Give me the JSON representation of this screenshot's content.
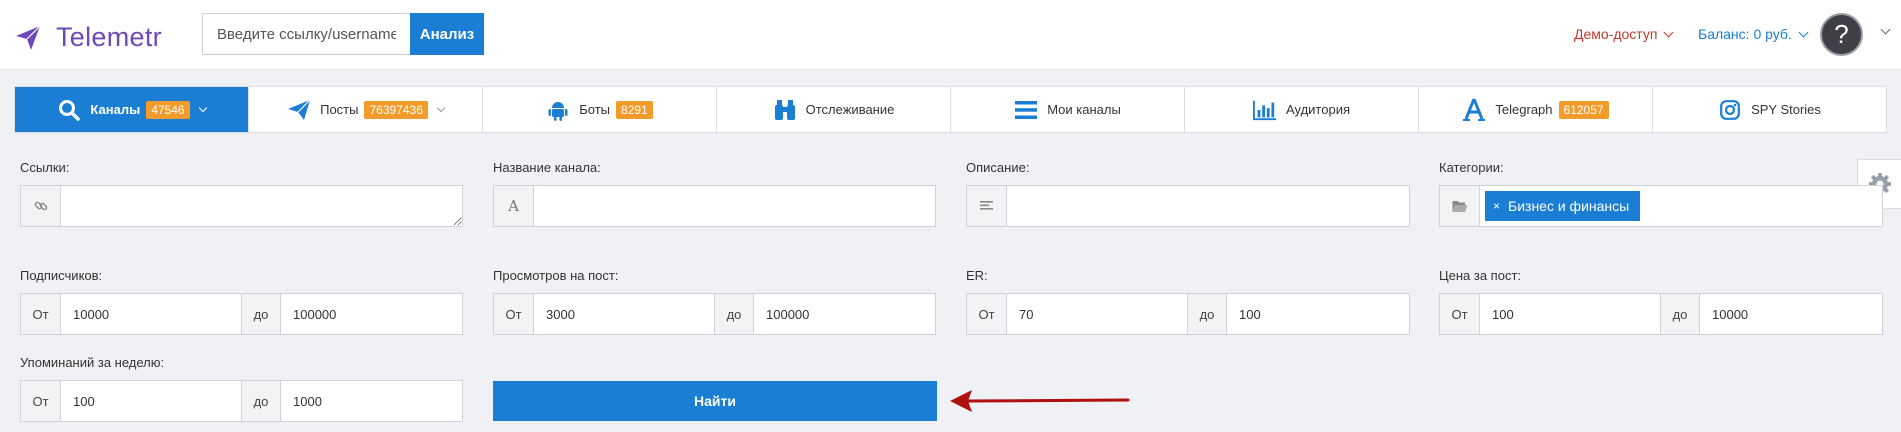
{
  "header": {
    "logo_text": "Telemetr",
    "search_placeholder": "Введите ссылку/username",
    "analyze_label": "Анализ",
    "demo_label": "Демо-доступ",
    "balance_label": "Баланс: 0 руб.",
    "avatar_glyph": "?"
  },
  "nav": {
    "tabs": [
      {
        "label": "Каналы",
        "badge": "47546"
      },
      {
        "label": "Посты",
        "badge": "76397436"
      },
      {
        "label": "Боты",
        "badge": "8291"
      },
      {
        "label": "Отслеживание"
      },
      {
        "label": "Мои каналы"
      },
      {
        "label": "Аудитория"
      },
      {
        "label": "Telegraph",
        "badge": "612057"
      },
      {
        "label": "SPY Stories"
      }
    ]
  },
  "filters": {
    "links_label": "Ссылки:",
    "channel_name_label": "Название канала:",
    "description_label": "Описание:",
    "categories_label": "Категории:",
    "category_chip": "Бизнес и финансы",
    "chip_remove": "×",
    "subscribers_label": "Подписчиков:",
    "views_label": "Просмотров на пост:",
    "er_label": "ER:",
    "price_label": "Цена за пост:",
    "mentions_label": "Упоминаний за неделю:",
    "from_label": "От",
    "to_label": "до",
    "subscribers_from": "10000",
    "subscribers_to": "100000",
    "views_from": "3000",
    "views_to": "100000",
    "er_from": "70",
    "er_to": "100",
    "price_from": "100",
    "price_to": "10000",
    "mentions_from": "100",
    "mentions_to": "1000",
    "text_icon_glyph": "A",
    "find_label": "Найти"
  },
  "colors": {
    "primary": "#1a7fd4",
    "badge": "#f39c2b",
    "logo": "#6d49b8",
    "demo": "#c0392b",
    "arrow": "#b01010"
  }
}
